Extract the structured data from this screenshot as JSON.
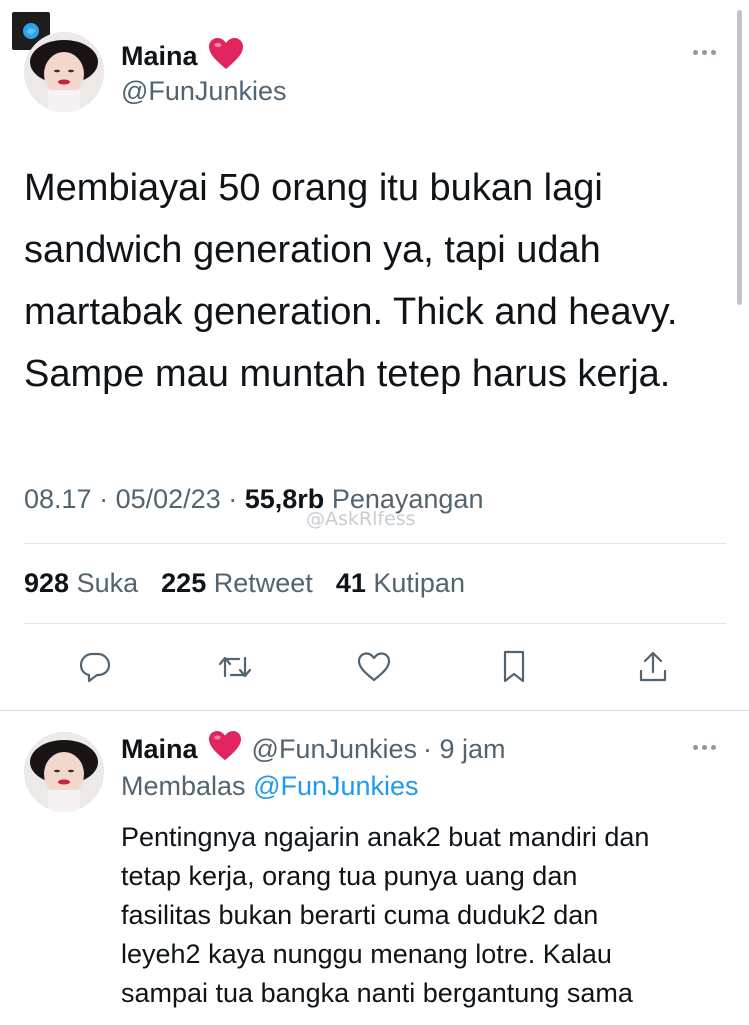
{
  "main_tweet": {
    "author_name": "Maina",
    "author_handle": "@FunJunkies",
    "text": "Membiayai 50 orang itu bukan lagi sandwich generation ya, tapi udah martabak generation. Thick and heavy. Sampe mau muntah tetep harus kerja.",
    "time": "08.17",
    "separator": "·",
    "date": "05/02/23",
    "views_count": "55,8rb",
    "views_label": "Penayangan",
    "watermark": "@AskRlfess"
  },
  "stats": {
    "likes_count": "928",
    "likes_label": "Suka",
    "retweets_count": "225",
    "retweets_label": "Retweet",
    "quotes_count": "41",
    "quotes_label": "Kutipan"
  },
  "actions": [
    "reply-icon",
    "retweet-icon",
    "like-icon",
    "bookmark-icon",
    "share-icon"
  ],
  "reply_tweet": {
    "author_name": "Maina",
    "author_handle": "@FunJunkies",
    "time_ago": "· 9 jam",
    "replying_prefix": "Membalas",
    "replying_to": "@FunJunkies",
    "line1": "Pentingnya ngajarin anak2 buat mandiri dan",
    "line2": "tetap kerja, orang tua punya uang dan",
    "line3": "fasilitas bukan berarti cuma duduk2 dan",
    "line4": "leyeh2 kaya nunggu menang lotre. Kalau",
    "line5": "sampai tua bangka nanti bergantung sama"
  },
  "colors": {
    "text": "#0f1419",
    "secondary": "#536471",
    "link": "#1d9bf0",
    "heart": "#e0245e"
  }
}
